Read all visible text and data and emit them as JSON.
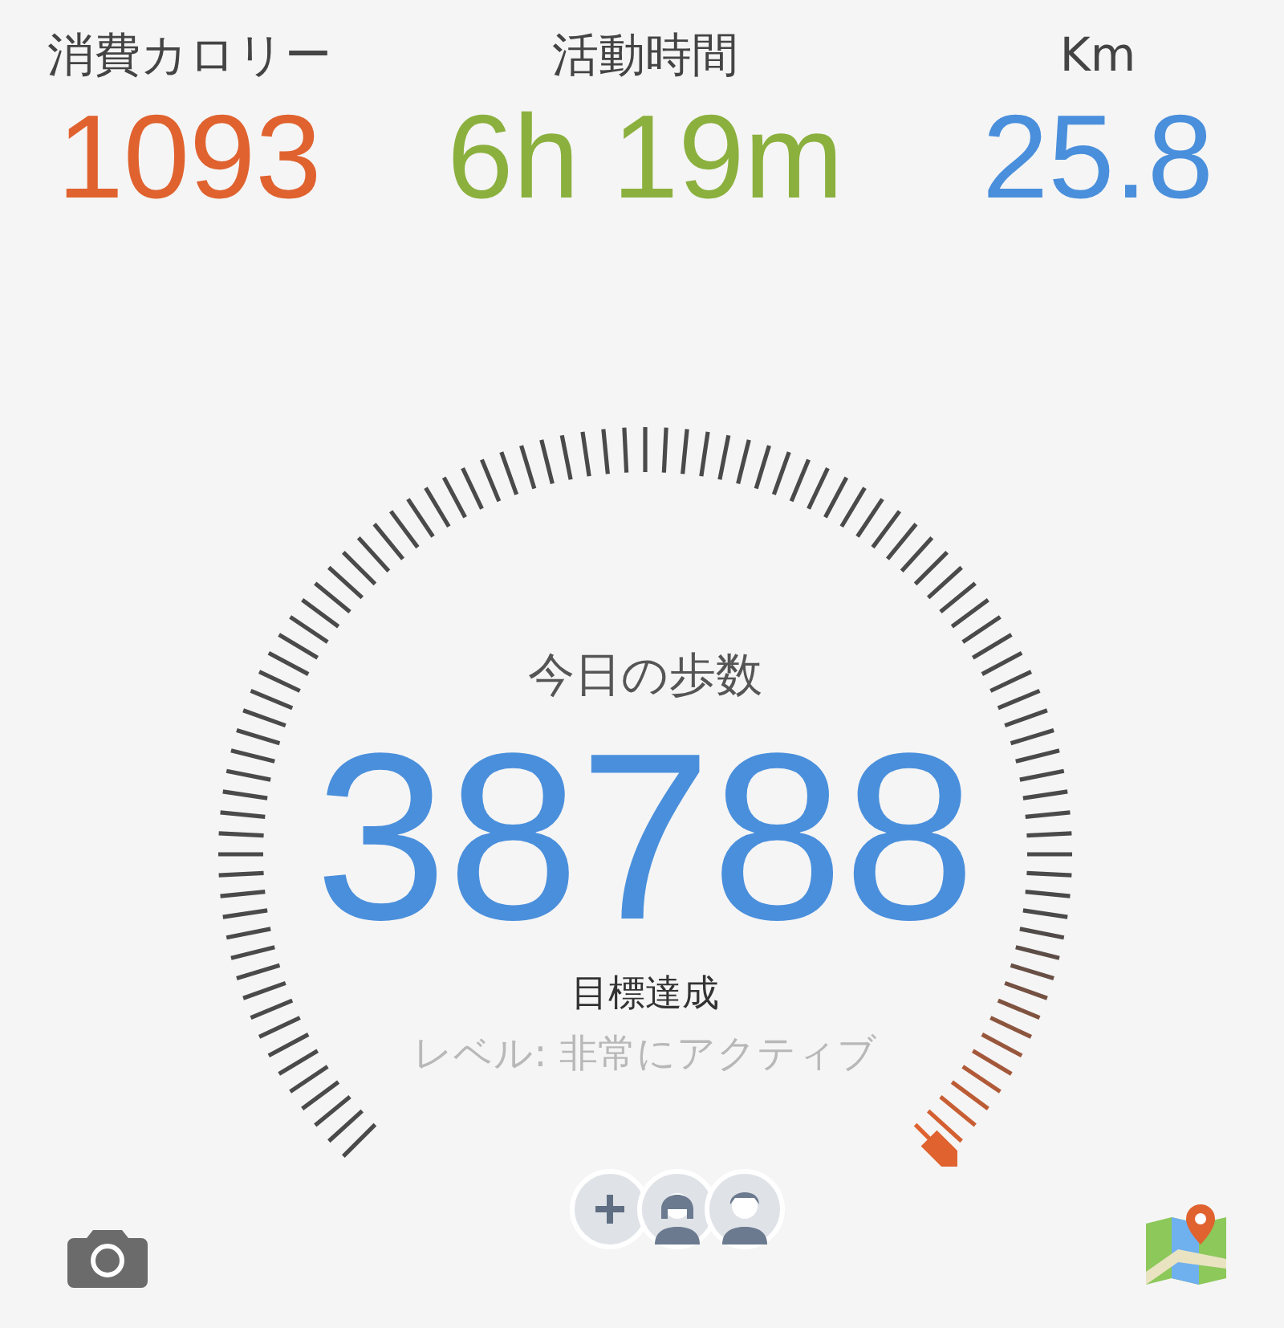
{
  "stats": [
    {
      "label": "消費カロリー",
      "value": "1093",
      "color": "#e0622f"
    },
    {
      "label": "活動時間",
      "value": "6h 19m",
      "color": "#8bb03e"
    },
    {
      "label": "Km",
      "value": "25.8",
      "color": "#4a8fdc"
    }
  ],
  "gauge": {
    "title": "今日の歩数",
    "steps": "38788",
    "status": "目標達成",
    "level_text": "レベル: 非常にアクティブ"
  }
}
